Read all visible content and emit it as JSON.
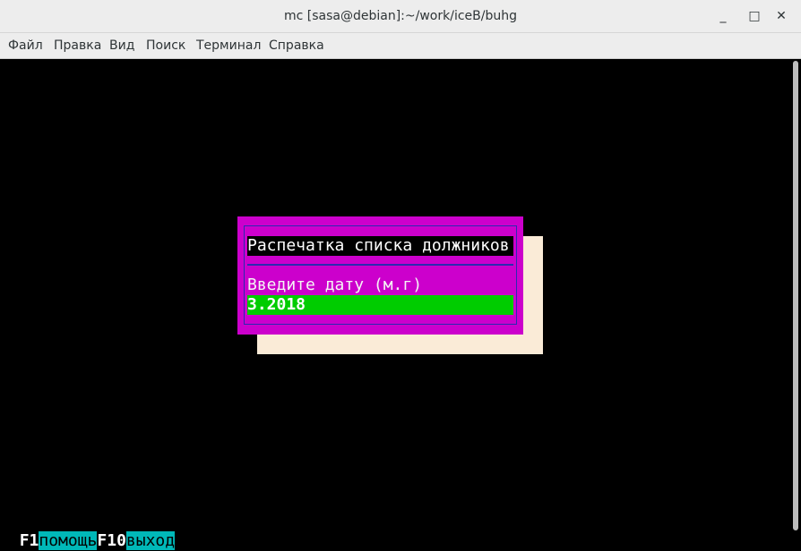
{
  "window": {
    "title": "mc [sasa@debian]:~/work/iceB/buhg",
    "minimize_glyph": "_",
    "maximize_glyph": "□",
    "close_glyph": "✕"
  },
  "menubar": {
    "items": [
      "Файл",
      "Правка",
      "Вид",
      "Поиск",
      "Терминал",
      "Справка"
    ]
  },
  "dialog": {
    "title": "Распечатка списка должников",
    "prompt": "Введите дату (м.г)",
    "input_value": "3.2018"
  },
  "footer": {
    "keys": [
      {
        "key": "F1",
        "label": "помощь"
      },
      {
        "key": "F10",
        "label": "выход"
      }
    ]
  },
  "colors": {
    "dialog_bg": "#cc00cc",
    "shadow": "#faebd7",
    "input_bg": "#00cc00",
    "fkey_label_bg": "#00b8b8",
    "terminal_bg": "#000000"
  }
}
